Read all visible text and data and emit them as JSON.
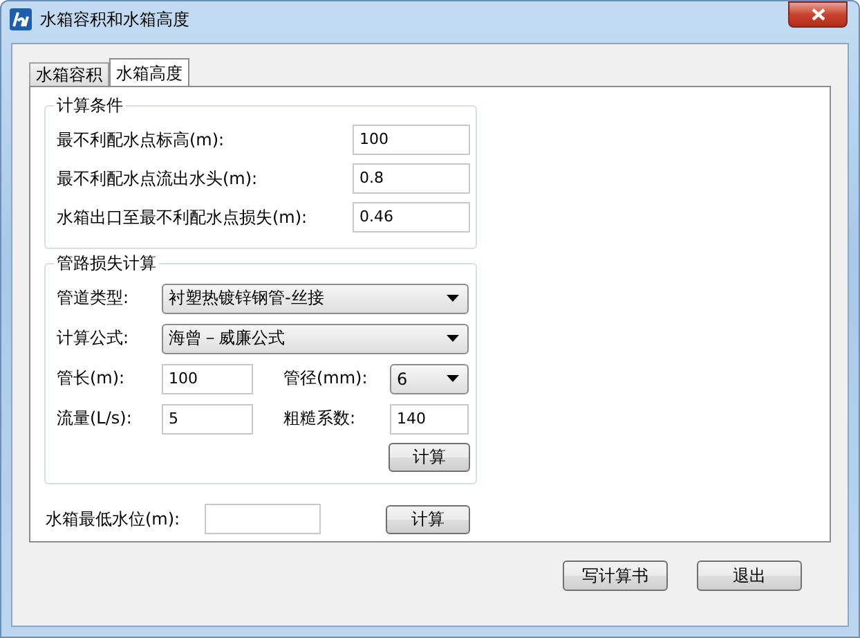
{
  "window": {
    "title": "水箱容积和水箱高度"
  },
  "tabs": [
    {
      "label": "水箱容积",
      "selected": false
    },
    {
      "label": "水箱高度",
      "selected": true
    }
  ],
  "conditions": {
    "title": "计算条件",
    "fields": [
      {
        "label": "最不利配水点标高(m):",
        "value": "100"
      },
      {
        "label": "最不利配水点流出水头(m):",
        "value": "0.8"
      },
      {
        "label": "水箱出口至最不利配水点损失(m):",
        "value": "0.46"
      }
    ]
  },
  "pipe_loss": {
    "title": "管路损失计算",
    "pipe_type": {
      "label": "管道类型:",
      "value": "衬塑热镀锌钢管-丝接"
    },
    "formula": {
      "label": "计算公式:",
      "value": "海曾－威廉公式"
    },
    "length": {
      "label": "管长(m):",
      "value": "100"
    },
    "diameter": {
      "label": "管径(mm):",
      "value": "6"
    },
    "flow": {
      "label": "流量(L/s):",
      "value": "5"
    },
    "roughness": {
      "label": "粗糙系数:",
      "value": "140"
    },
    "button": "计算"
  },
  "min_level": {
    "label": "水箱最低水位(m):",
    "button": "计算"
  },
  "buttons": [
    "写计算书",
    "退出"
  ]
}
